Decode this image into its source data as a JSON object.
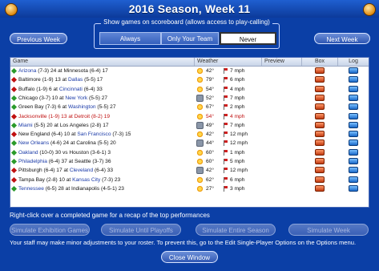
{
  "window": {
    "title": "2016 Season, Week 11"
  },
  "nav": {
    "previous_label": "Previous Week",
    "next_label": "Next Week"
  },
  "scoreboard_filter": {
    "legend": "Show games on scoreboard (allows access to play-calling)",
    "options": [
      {
        "label": "Always",
        "selected": false
      },
      {
        "label": "Only Your Team",
        "selected": false
      },
      {
        "label": "Never",
        "selected": true
      }
    ]
  },
  "table": {
    "columns": [
      "Game",
      "Weather",
      "Preview",
      "Box",
      "Log"
    ],
    "rows": [
      {
        "marker": "#2a9a2a",
        "t1": "Arizona",
        "t1_rec": "(7-3) 24 at",
        "t2": "Minnesota",
        "t2_rec": "(6-4) 17",
        "t1_link": true,
        "t2_link": false,
        "temp": "42°",
        "wind": "7 mph",
        "icon": "sun",
        "red": false
      },
      {
        "marker": "#c01010",
        "t1": "Baltimore",
        "t1_rec": "(1-9) 13 at",
        "t2": "Dallas",
        "t2_rec": "(5-5) 17",
        "t1_link": false,
        "t2_link": true,
        "temp": "79°",
        "wind": "6 mph",
        "icon": "sun",
        "red": false
      },
      {
        "marker": "#c01010",
        "t1": "Buffalo",
        "t1_rec": "(1-9) 6 at",
        "t2": "Cincinnati",
        "t2_rec": "(6-4) 33",
        "t1_link": false,
        "t2_link": true,
        "temp": "54°",
        "wind": "4 mph",
        "icon": "sun",
        "red": false
      },
      {
        "marker": "#2a9a2a",
        "t1": "Chicago",
        "t1_rec": "(3-7) 10 at",
        "t2": "New York",
        "t2_rec": "(5-5) 27",
        "t1_link": false,
        "t2_link": true,
        "temp": "52°",
        "wind": "7 mph",
        "icon": "cloud",
        "red": false
      },
      {
        "marker": "#2a9a2a",
        "t1": "Green Bay",
        "t1_rec": "(7-3) 6 at",
        "t2": "Washington",
        "t2_rec": "(5-5) 27",
        "t1_link": false,
        "t2_link": true,
        "temp": "67°",
        "wind": "2 mph",
        "icon": "sun",
        "red": false
      },
      {
        "marker": "#c01010",
        "t1": "Jacksonville",
        "t1_rec": "(1-9) 13 at",
        "t2": "Detroit",
        "t2_rec": "(8-2) 19",
        "t1_link": false,
        "t2_link": false,
        "temp": "54°",
        "wind": "4 mph",
        "icon": "sun",
        "red": true
      },
      {
        "marker": "#2a9a2a",
        "t1": "Miami",
        "t1_rec": "(5-5) 20 at Los Angeles (2-8) 17",
        "t2": "",
        "t2_rec": "",
        "t1_link": true,
        "t2_link": false,
        "temp": "49°",
        "wind": "7 mph",
        "icon": "cloud",
        "red": false
      },
      {
        "marker": "#c01010",
        "t1": "New England",
        "t1_rec": "(6-4) 10 at",
        "t2": "San Francisco",
        "t2_rec": "(7-3) 15",
        "t1_link": false,
        "t2_link": true,
        "temp": "42°",
        "wind": "12 mph",
        "icon": "sun",
        "red": false
      },
      {
        "marker": "#2a9a2a",
        "t1": "New Orleans",
        "t1_rec": "(4-6) 24 at Carolina (5-5) 20",
        "t2": "",
        "t2_rec": "",
        "t1_link": true,
        "t2_link": false,
        "temp": "44°",
        "wind": "12 mph",
        "icon": "cloud",
        "red": false
      },
      {
        "marker": "#2a9a2a",
        "t1": "Oakland",
        "t1_rec": "(10-0) 30 vs Houston (3-6-1) 3",
        "t2": "",
        "t2_rec": "",
        "t1_link": true,
        "t2_link": false,
        "temp": "60°",
        "wind": "1 mph",
        "icon": "sun",
        "red": false
      },
      {
        "marker": "#2a9a2a",
        "t1": "Philadelphia",
        "t1_rec": "(6-4) 37 at Seattle (3-7) 36",
        "t2": "",
        "t2_rec": "",
        "t1_link": true,
        "t2_link": false,
        "temp": "60°",
        "wind": "5 mph",
        "icon": "sun",
        "red": false
      },
      {
        "marker": "#c01010",
        "t1": "Pittsburgh",
        "t1_rec": "(6-4) 17 at",
        "t2": "Cleveland",
        "t2_rec": "(6-4) 33",
        "t1_link": false,
        "t2_link": true,
        "temp": "42°",
        "wind": "12 mph",
        "icon": "cloud",
        "red": false
      },
      {
        "marker": "#c01010",
        "t1": "Tampa Bay",
        "t1_rec": "(2-8) 10 at",
        "t2": "Kansas City",
        "t2_rec": "(7-3) 23",
        "t1_link": false,
        "t2_link": true,
        "temp": "62°",
        "wind": "6 mph",
        "icon": "sun",
        "red": false
      },
      {
        "marker": "#2a9a2a",
        "t1": "Tennessee",
        "t1_rec": "(6-5) 28 at Indianapolis (4-5-1) 23",
        "t2": "",
        "t2_rec": "",
        "t1_link": true,
        "t2_link": false,
        "temp": "27°",
        "wind": "3 mph",
        "icon": "sun",
        "red": false
      }
    ]
  },
  "hint": "Right-click over a completed game for a recap of the top performances",
  "sim_buttons": [
    "Simulate Exhibition Games",
    "Simulate Until Playoffs",
    "Simulate Entire Season",
    "Simulate Week"
  ],
  "staff_note": "Your staff may make minor adjustments to your roster. To prevent this, go to the Edit Single-Player Options on the Options menu.",
  "close_label": "Close Window"
}
